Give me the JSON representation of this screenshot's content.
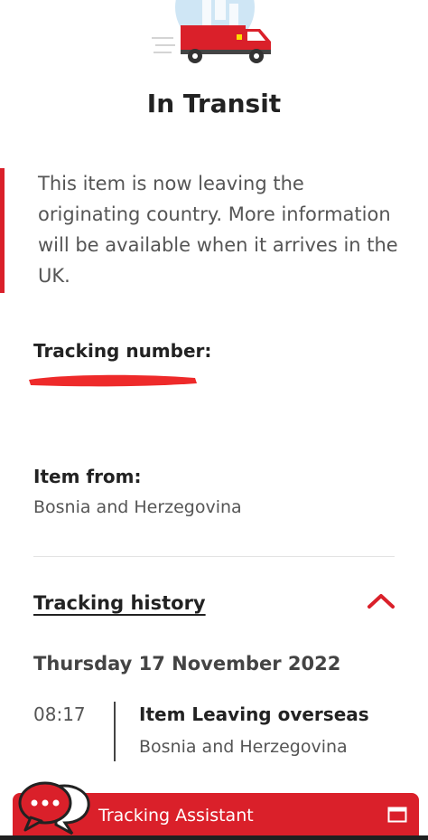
{
  "status": {
    "title": "In Transit",
    "message": "This item is now leaving the originating country. More information will be available when it arrives in the UK."
  },
  "tracking": {
    "number_label": "Tracking number:",
    "item_from_label": "Item from:",
    "item_from_value": "Bosnia and Herzegovina"
  },
  "history": {
    "link_label": "Tracking history",
    "expanded": true,
    "date": "Thursday 17 November 2022",
    "events": [
      {
        "time": "08:17",
        "title": "Item Leaving overseas",
        "place": "Bosnia and Herzegovina"
      }
    ]
  },
  "assistant": {
    "label": "Tracking Assistant"
  },
  "colors": {
    "brand_red": "#da202a",
    "text_dark": "#222222",
    "text_muted": "#555555"
  },
  "icons": [
    "van-illustration",
    "chevron-up-icon",
    "chat-bubble-icon",
    "window-icon"
  ]
}
